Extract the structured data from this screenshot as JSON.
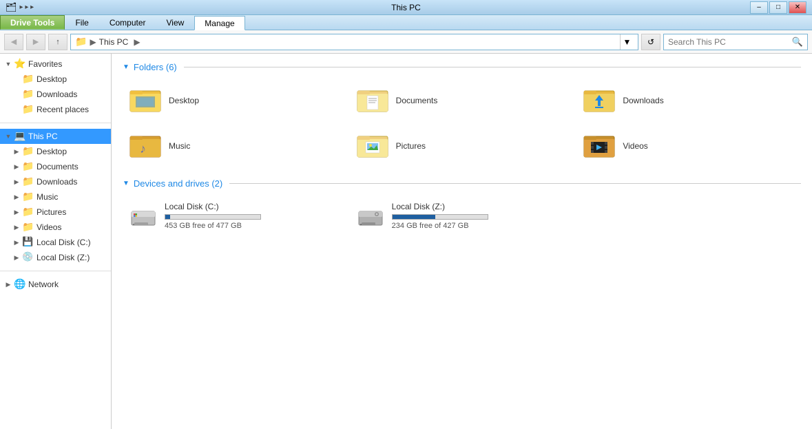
{
  "titlebar": {
    "title": "This PC",
    "drive_tools_label": "Drive Tools",
    "min_btn": "–",
    "max_btn": "□",
    "close_btn": "✕"
  },
  "ribbon": {
    "tabs": [
      {
        "id": "file",
        "label": "File",
        "active": false
      },
      {
        "id": "computer",
        "label": "Computer",
        "active": false
      },
      {
        "id": "view",
        "label": "View",
        "active": false
      },
      {
        "id": "manage",
        "label": "Manage",
        "active": true
      }
    ],
    "drive_tools_label": "Drive Tools"
  },
  "addressbar": {
    "path_label": "This PC",
    "path_arrow": "▶",
    "search_placeholder": "Search This PC",
    "search_label": "Search"
  },
  "sidebar": {
    "favorites_label": "Favorites",
    "favorites_items": [
      {
        "id": "desktop",
        "label": "Desktop"
      },
      {
        "id": "downloads",
        "label": "Downloads"
      },
      {
        "id": "recent-places",
        "label": "Recent places"
      }
    ],
    "this_pc_label": "This PC",
    "this_pc_items": [
      {
        "id": "desktop2",
        "label": "Desktop"
      },
      {
        "id": "documents",
        "label": "Documents"
      },
      {
        "id": "downloads2",
        "label": "Downloads"
      },
      {
        "id": "music",
        "label": "Music"
      },
      {
        "id": "pictures",
        "label": "Pictures"
      },
      {
        "id": "videos",
        "label": "Videos"
      },
      {
        "id": "local-c",
        "label": "Local Disk (C:)"
      },
      {
        "id": "local-z",
        "label": "Local Disk (Z:)"
      }
    ],
    "network_label": "Network"
  },
  "content": {
    "folders_section_label": "Folders (6)",
    "folders": [
      {
        "id": "desktop",
        "label": "Desktop",
        "icon_type": "desktop"
      },
      {
        "id": "documents",
        "label": "Documents",
        "icon_type": "documents"
      },
      {
        "id": "downloads",
        "label": "Downloads",
        "icon_type": "downloads"
      },
      {
        "id": "music",
        "label": "Music",
        "icon_type": "music"
      },
      {
        "id": "pictures",
        "label": "Pictures",
        "icon_type": "pictures"
      },
      {
        "id": "videos",
        "label": "Videos",
        "icon_type": "videos"
      }
    ],
    "devices_section_label": "Devices and drives (2)",
    "drives": [
      {
        "id": "local-c",
        "label": "Local Disk (C:)",
        "free_text": "453 GB free of 477 GB",
        "bar_percent": 5,
        "bar_color": "#1e88e5",
        "icon_type": "windows-drive"
      },
      {
        "id": "local-z",
        "label": "Local Disk (Z:)",
        "free_text": "234 GB free of 427 GB",
        "bar_percent": 45,
        "bar_color": "#1e88e5",
        "icon_type": "disk-drive"
      }
    ]
  },
  "statusbar": {
    "text": ""
  }
}
